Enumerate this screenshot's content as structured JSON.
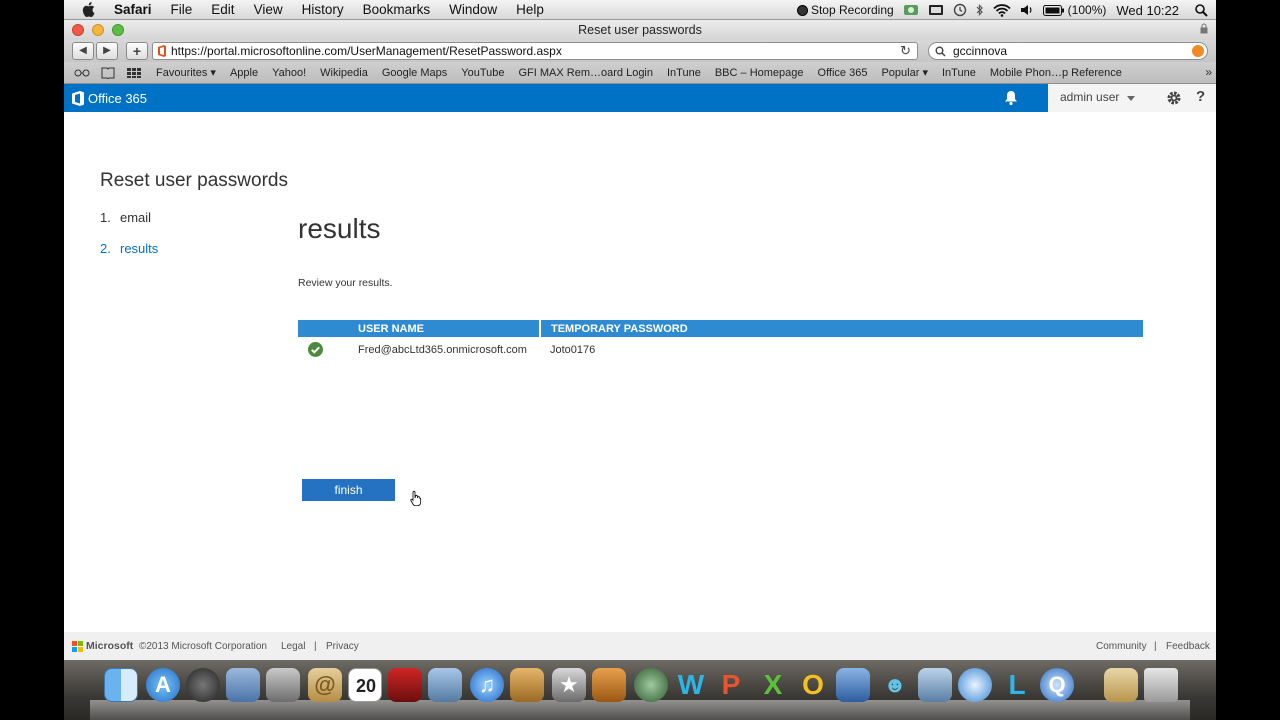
{
  "menubar": {
    "app": "Safari",
    "items": [
      "File",
      "Edit",
      "View",
      "History",
      "Bookmarks",
      "Window",
      "Help"
    ],
    "status": {
      "recording": "Stop Recording",
      "battery": "(100%)",
      "clock": "Wed 10:22"
    }
  },
  "browser": {
    "title": "Reset user passwords",
    "url": "https://portal.microsoftonline.com/UserManagement/ResetPassword.aspx",
    "search_value": "gccinnova",
    "bookmarks": [
      "Favourites ▾",
      "Apple",
      "Yahoo!",
      "Wikipedia",
      "Google Maps",
      "YouTube",
      "GFI MAX Rem…oard Login",
      "InTune",
      "BBC – Homepage",
      "Office 365",
      "Popular ▾",
      "InTune",
      "Mobile Phon…p Reference"
    ]
  },
  "o365": {
    "brand": "Office 365",
    "user": "admin user",
    "help": "?"
  },
  "page": {
    "title": "Reset user passwords",
    "steps": [
      {
        "num": "1.",
        "label": "email"
      },
      {
        "num": "2.",
        "label": "results"
      }
    ],
    "section_title": "results",
    "review_text": "Review your results.",
    "table": {
      "headers": [
        "USER NAME",
        "TEMPORARY PASSWORD"
      ],
      "rows": [
        {
          "user": "Fred@abcLtd365.onmicrosoft.com",
          "password": "Joto0176"
        }
      ]
    },
    "finish_label": "finish"
  },
  "footer": {
    "microsoft": "Microsoft",
    "copyright": "©2013 Microsoft Corporation",
    "legal": "Legal",
    "privacy": "Privacy",
    "community": "Community",
    "feedback": "Feedback",
    "separator": "|"
  },
  "colors": {
    "o365_blue": "#0072c6",
    "table_header": "#2e8ad1",
    "finish_button": "#2672c2",
    "success_check": "#4e8a3e"
  }
}
